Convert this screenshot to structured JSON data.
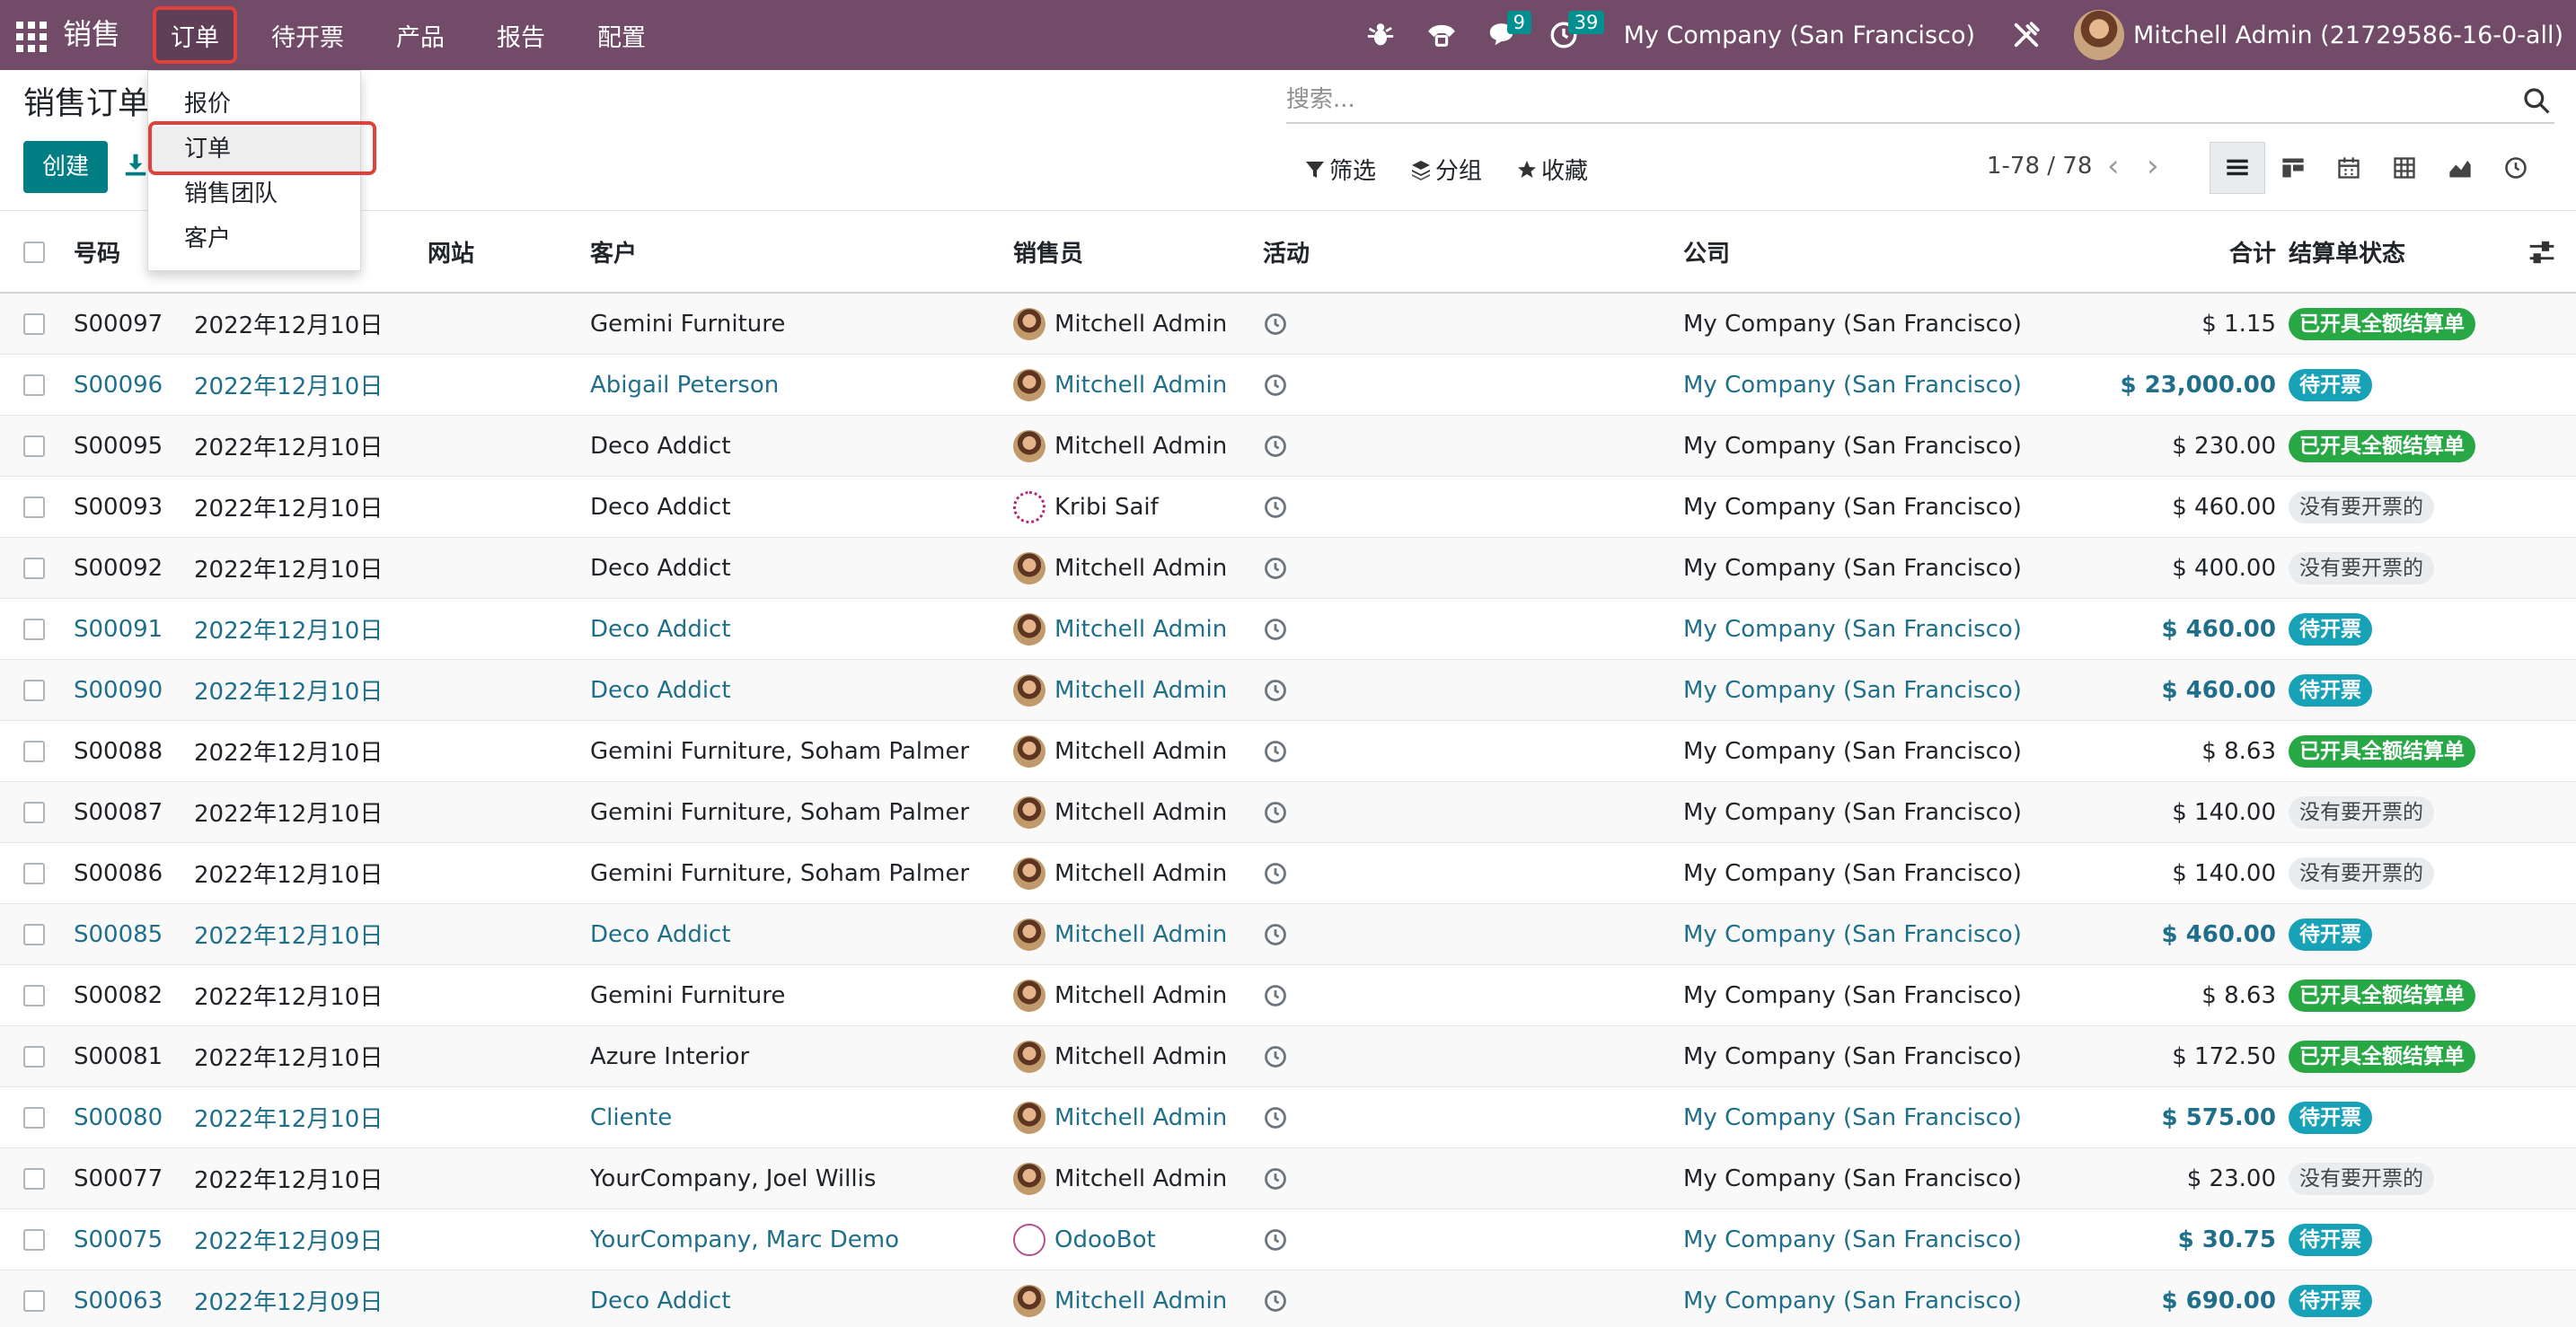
{
  "app": {
    "brand": "销售"
  },
  "menu": [
    {
      "label": "订单",
      "active": true
    },
    {
      "label": "待开票"
    },
    {
      "label": "产品"
    },
    {
      "label": "报告"
    },
    {
      "label": "配置"
    }
  ],
  "nav_right": {
    "messages_count": "9",
    "activities_count": "39",
    "company": "My Company (San Francisco)",
    "user": "Mitchell Admin (21729586-16-0-all)"
  },
  "dropdown": [
    {
      "label": "报价"
    },
    {
      "label": "订单",
      "active": true
    },
    {
      "label": "销售团队"
    },
    {
      "label": "客户"
    }
  ],
  "page": {
    "title": "销售订单",
    "create_label": "创建"
  },
  "search": {
    "placeholder": "搜索..."
  },
  "filters": {
    "filter": "筛选",
    "group": "分组",
    "favorites": "收藏"
  },
  "pager": {
    "text": "1-78 / 78"
  },
  "columns": {
    "number": "号码",
    "date": "",
    "website": "网站",
    "customer": "客户",
    "salesperson": "销售员",
    "activity": "活动",
    "company": "公司",
    "total": "合计",
    "invoice_status": "结算单状态"
  },
  "status_colors": {
    "invoiced": "#28a745",
    "to_invoice": "#17a2b8",
    "nothing": "#e9ecef"
  },
  "rows": [
    {
      "number": "S00097",
      "date": "2022年12月10日",
      "customer": "Gemini Furniture",
      "salesperson": "Mitchell Admin",
      "avatar": "ma",
      "company": "My Company (San Francisco)",
      "total": "$ 1.15",
      "status": "已开具全额结算单",
      "status_kind": "green",
      "link": false
    },
    {
      "number": "S00096",
      "date": "2022年12月10日",
      "customer": "Abigail Peterson",
      "salesperson": "Mitchell Admin",
      "avatar": "ma",
      "company": "My Company (San Francisco)",
      "total": "$ 23,000.00",
      "status": "待开票",
      "status_kind": "blue",
      "link": true
    },
    {
      "number": "S00095",
      "date": "2022年12月10日",
      "customer": "Deco Addict",
      "salesperson": "Mitchell Admin",
      "avatar": "ma",
      "company": "My Company (San Francisco)",
      "total": "$ 230.00",
      "status": "已开具全额结算单",
      "status_kind": "green",
      "link": false
    },
    {
      "number": "S00093",
      "date": "2022年12月10日",
      "customer": "Deco Addict",
      "salesperson": "Kribi Saif",
      "avatar": "ks",
      "company": "My Company (San Francisco)",
      "total": "$ 460.00",
      "status": "没有要开票的",
      "status_kind": "grey",
      "link": false
    },
    {
      "number": "S00092",
      "date": "2022年12月10日",
      "customer": "Deco Addict",
      "salesperson": "Mitchell Admin",
      "avatar": "ma",
      "company": "My Company (San Francisco)",
      "total": "$ 400.00",
      "status": "没有要开票的",
      "status_kind": "grey",
      "link": false
    },
    {
      "number": "S00091",
      "date": "2022年12月10日",
      "customer": "Deco Addict",
      "salesperson": "Mitchell Admin",
      "avatar": "ma",
      "company": "My Company (San Francisco)",
      "total": "$ 460.00",
      "status": "待开票",
      "status_kind": "blue",
      "link": true
    },
    {
      "number": "S00090",
      "date": "2022年12月10日",
      "customer": "Deco Addict",
      "salesperson": "Mitchell Admin",
      "avatar": "ma",
      "company": "My Company (San Francisco)",
      "total": "$ 460.00",
      "status": "待开票",
      "status_kind": "blue",
      "link": true
    },
    {
      "number": "S00088",
      "date": "2022年12月10日",
      "customer": "Gemini Furniture, Soham Palmer",
      "salesperson": "Mitchell Admin",
      "avatar": "ma",
      "company": "My Company (San Francisco)",
      "total": "$ 8.63",
      "status": "已开具全额结算单",
      "status_kind": "green",
      "link": false
    },
    {
      "number": "S00087",
      "date": "2022年12月10日",
      "customer": "Gemini Furniture, Soham Palmer",
      "salesperson": "Mitchell Admin",
      "avatar": "ma",
      "company": "My Company (San Francisco)",
      "total": "$ 140.00",
      "status": "没有要开票的",
      "status_kind": "grey",
      "link": false
    },
    {
      "number": "S00086",
      "date": "2022年12月10日",
      "customer": "Gemini Furniture, Soham Palmer",
      "salesperson": "Mitchell Admin",
      "avatar": "ma",
      "company": "My Company (San Francisco)",
      "total": "$ 140.00",
      "status": "没有要开票的",
      "status_kind": "grey",
      "link": false
    },
    {
      "number": "S00085",
      "date": "2022年12月10日",
      "customer": "Deco Addict",
      "salesperson": "Mitchell Admin",
      "avatar": "ma",
      "company": "My Company (San Francisco)",
      "total": "$ 460.00",
      "status": "待开票",
      "status_kind": "blue",
      "link": true
    },
    {
      "number": "S00082",
      "date": "2022年12月10日",
      "customer": "Gemini Furniture",
      "salesperson": "Mitchell Admin",
      "avatar": "ma",
      "company": "My Company (San Francisco)",
      "total": "$ 8.63",
      "status": "已开具全额结算单",
      "status_kind": "green",
      "link": false
    },
    {
      "number": "S00081",
      "date": "2022年12月10日",
      "customer": "Azure Interior",
      "salesperson": "Mitchell Admin",
      "avatar": "ma",
      "company": "My Company (San Francisco)",
      "total": "$ 172.50",
      "status": "已开具全额结算单",
      "status_kind": "green",
      "link": false
    },
    {
      "number": "S00080",
      "date": "2022年12月10日",
      "customer": "Cliente",
      "salesperson": "Mitchell Admin",
      "avatar": "ma",
      "company": "My Company (San Francisco)",
      "total": "$ 575.00",
      "status": "待开票",
      "status_kind": "blue",
      "link": true
    },
    {
      "number": "S00077",
      "date": "2022年12月10日",
      "customer": "YourCompany, Joel Willis",
      "salesperson": "Mitchell Admin",
      "avatar": "ma",
      "company": "My Company (San Francisco)",
      "total": "$ 23.00",
      "status": "没有要开票的",
      "status_kind": "grey",
      "link": false
    },
    {
      "number": "S00075",
      "date": "2022年12月09日",
      "customer": "YourCompany, Marc Demo",
      "salesperson": "OdooBot",
      "avatar": "ob",
      "company": "My Company (San Francisco)",
      "total": "$ 30.75",
      "status": "待开票",
      "status_kind": "blue",
      "link": true
    },
    {
      "number": "S00063",
      "date": "2022年12月09日",
      "customer": "Deco Addict",
      "salesperson": "Mitchell Admin",
      "avatar": "ma",
      "company": "My Company (San Francisco)",
      "total": "$ 690.00",
      "status": "待开票",
      "status_kind": "blue",
      "link": true
    }
  ]
}
